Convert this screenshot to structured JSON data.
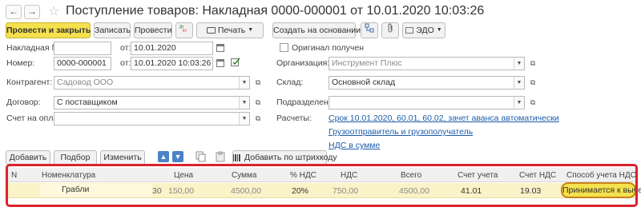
{
  "window": {
    "title": "Поступление товаров: Накладная 0000-000001 от 10.01.2020 10:03:26",
    "back_glyph": "←",
    "forward_glyph": "→",
    "star_glyph": "☆"
  },
  "toolbar": {
    "post_close": "Провести и закрыть",
    "save": "Записать",
    "post": "Провести",
    "print": "Печать",
    "create_based": "Создать на основании",
    "edo": "ЭДО"
  },
  "form": {
    "invoice_no_label": "Накладная №:",
    "from_label": "от:",
    "invoice_date": "10.01.2020",
    "number_label": "Номер:",
    "number_value": "0000-000001",
    "number_datetime": "10.01.2020 10:03:26",
    "original_received_label": "Оригинал получен",
    "counterparty_label": "Контрагент:",
    "counterparty_value": "Садовод ООО",
    "organization_label": "Организация:",
    "organization_value": "Инструмент Плюс",
    "contract_label": "Договор:",
    "contract_value": "С поставщиком",
    "warehouse_label": "Склад:",
    "warehouse_value": "Основной склад",
    "payment_invoice_label": "Счет на оплату:",
    "subdivision_label": "Подразделение:",
    "settlements_label": "Расчеты:",
    "settlements_link": "Срок 10.01.2020, 60.01, 60.02, зачет аванса автоматически",
    "consignor_link": "Грузоотправитель и грузополучатель",
    "vat_link": "НДС в сумме"
  },
  "table_toolbar": {
    "add": "Добавить",
    "pick": "Подбор",
    "change": "Изменить",
    "add_barcode": "Добавить по штрихкоду"
  },
  "table": {
    "headers": [
      "N",
      "Номенклатура",
      "Цена",
      "Сумма",
      "% НДС",
      "НДС",
      "Всего",
      "Счет учета",
      "Счет НДС",
      "Способ учета НДС"
    ],
    "row": {
      "item": "Грабли",
      "qty": "30",
      "price": "150,00",
      "sum": "4500,00",
      "vat_rate": "20%",
      "vat": "750,00",
      "total": "4500,00",
      "account": "41.01",
      "vat_account": "19.03",
      "vat_method": "Принимается к вычету"
    }
  }
}
